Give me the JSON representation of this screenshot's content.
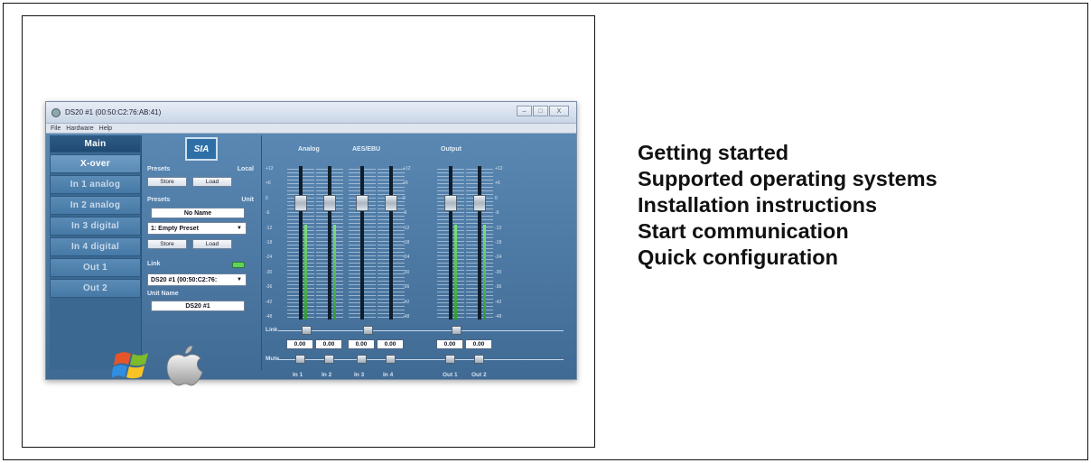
{
  "window": {
    "title": "DS20 #1 (00:50:C2:76:AB:41)",
    "controls": [
      "–",
      "□",
      "X"
    ]
  },
  "menu": [
    "File",
    "Hardware",
    "Help"
  ],
  "nav": {
    "items": [
      "Main",
      "X-over",
      "In 1 analog",
      "In 2 analog",
      "In 3 digital",
      "In 4 digital",
      "Out 1",
      "Out 2"
    ],
    "active": "Main"
  },
  "presets_panel": {
    "logo_text": "SIA",
    "local_label": "Presets",
    "local_right": "Local",
    "store_label": "Store",
    "load_label": "Load",
    "unit_label": "Presets",
    "unit_right": "Unit",
    "preset_name": "No Name",
    "preset_select": "1: Empty Preset",
    "link_label": "Link",
    "device_select": "DS20 #1 (00:50:C2:76:",
    "unit_name_label": "Unit Name",
    "unit_name_value": "DS20 #1"
  },
  "mixer": {
    "groups": [
      "Analog",
      "AES/EBU",
      "Output"
    ],
    "scale_left": [
      "+12",
      "+6",
      "0",
      "-6",
      "-12",
      "-18",
      "-24",
      "-30",
      "-36",
      "-42",
      "-48"
    ],
    "scale_mid": [
      "+12",
      "+6",
      "0",
      "-6",
      "-12",
      "-18",
      "-24",
      "-30",
      "-36",
      "-42",
      "-48"
    ],
    "scale_right": [
      "+12",
      "+6",
      "0",
      "-6",
      "-12",
      "-18",
      "-24",
      "-30",
      "-36",
      "-42",
      "-48"
    ],
    "link_label": "Link",
    "mute_label": "Mute",
    "channels": [
      {
        "label": "In 1",
        "value": "0.00",
        "fader_level": 0.76,
        "meter_level": 0.62
      },
      {
        "label": "In 2",
        "value": "0.00",
        "fader_level": 0.76,
        "meter_level": 0.62
      },
      {
        "label": "In 3",
        "value": "0.00",
        "fader_level": 0.76,
        "meter_level": 0.0
      },
      {
        "label": "In 4",
        "value": "0.00",
        "fader_level": 0.76,
        "meter_level": 0.0
      },
      {
        "label": "Out 1",
        "value": "0.00",
        "fader_level": 0.76,
        "meter_level": 0.62
      },
      {
        "label": "Out 2",
        "value": "0.00",
        "fader_level": 0.76,
        "meter_level": 0.62
      }
    ]
  },
  "os_icons": [
    "windows-logo-icon",
    "apple-logo-icon"
  ],
  "topics": [
    "Getting started",
    "Supported operating systems",
    "Installation instructions",
    "Start communication",
    "Quick configuration"
  ],
  "colors": {
    "app_bg": "#4f7aa0",
    "nav_active": "#1f4a72",
    "meter_green": "#5fd35a",
    "text_dark": "#111111"
  }
}
